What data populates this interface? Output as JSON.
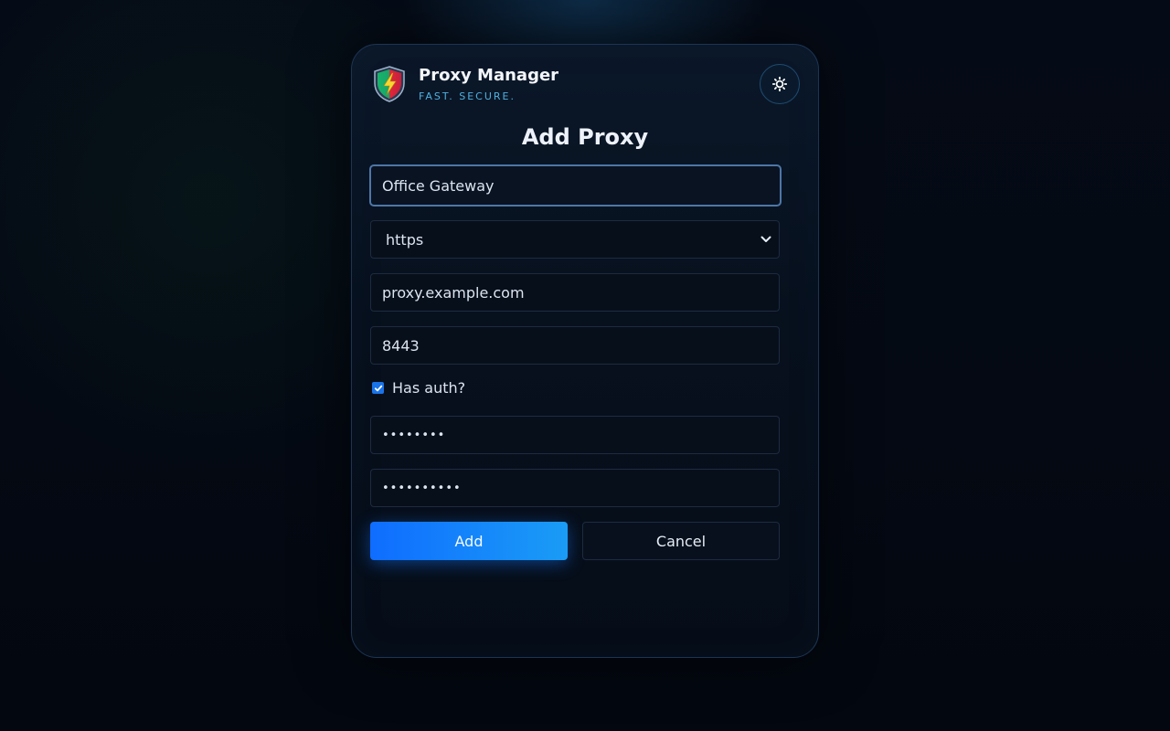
{
  "app": {
    "title": "Proxy Manager",
    "tagline": "FAST. SECURE."
  },
  "form": {
    "heading": "Add Proxy",
    "name_value": "Office Gateway",
    "protocol_value": "https",
    "host_value": "proxy.example.com",
    "port_value": "8443",
    "has_auth_label": "Has auth?",
    "has_auth_checked": true,
    "username_masked": "••••••••",
    "password_masked": "••••••••••",
    "add_label": "Add",
    "cancel_label": "Cancel"
  },
  "icons": {
    "logo": "shield-lightning-icon",
    "theme_toggle": "sun-icon",
    "dropdown": "chevron-down-icon",
    "checkbox": "check-icon"
  },
  "colors": {
    "accent": "#1a73e8",
    "button_gradient_start": "#0f6dff",
    "button_gradient_end": "#1a9cf6",
    "tagline": "#4fb0e0"
  }
}
